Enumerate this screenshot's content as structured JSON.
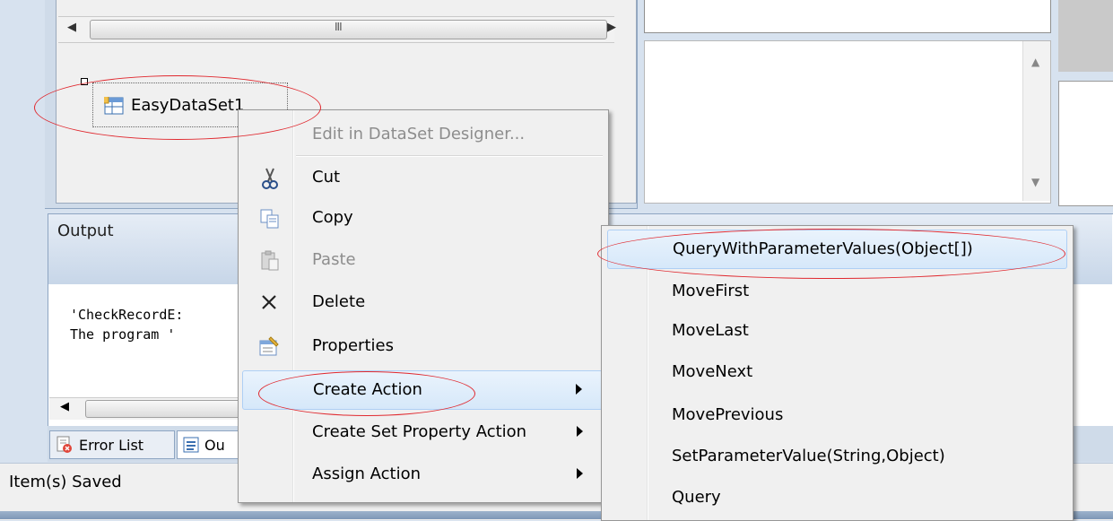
{
  "designer": {
    "scroll_grip": "III",
    "component_name": "EasyDataSet1"
  },
  "output": {
    "title": "Output",
    "lines": [
      "'CheckRecordE:",
      "The program '"
    ]
  },
  "tabs": {
    "error_list": "Error List",
    "output": "Ou"
  },
  "status": {
    "text": "Item(s) Saved"
  },
  "context_menu": {
    "items": [
      {
        "label": "Edit in DataSet Designer...",
        "enabled": false
      },
      {
        "label": "Cut",
        "icon": "scissors-icon"
      },
      {
        "label": "Copy",
        "icon": "copy-icon"
      },
      {
        "label": "Paste",
        "icon": "paste-icon",
        "enabled": false
      },
      {
        "label": "Delete",
        "icon": "delete-x-icon"
      },
      {
        "label": "Properties",
        "icon": "properties-icon"
      },
      {
        "label": "Create Action",
        "has_submenu": true,
        "highlighted": true
      },
      {
        "label": "Create Set Property Action",
        "has_submenu": true
      },
      {
        "label": "Assign Action",
        "has_submenu": true
      }
    ]
  },
  "submenu": {
    "items": [
      {
        "label": "QueryWithParameterValues(Object[])",
        "highlighted": true
      },
      {
        "label": "MoveFirst"
      },
      {
        "label": "MoveLast"
      },
      {
        "label": "MoveNext"
      },
      {
        "label": "MovePrevious"
      },
      {
        "label": "SetParameterValue(String,Object)"
      },
      {
        "label": "Query"
      }
    ]
  },
  "colors": {
    "annotation": "#e0292f",
    "menu_highlight": "#d6e8fa",
    "chrome": "#cfdbe9"
  }
}
